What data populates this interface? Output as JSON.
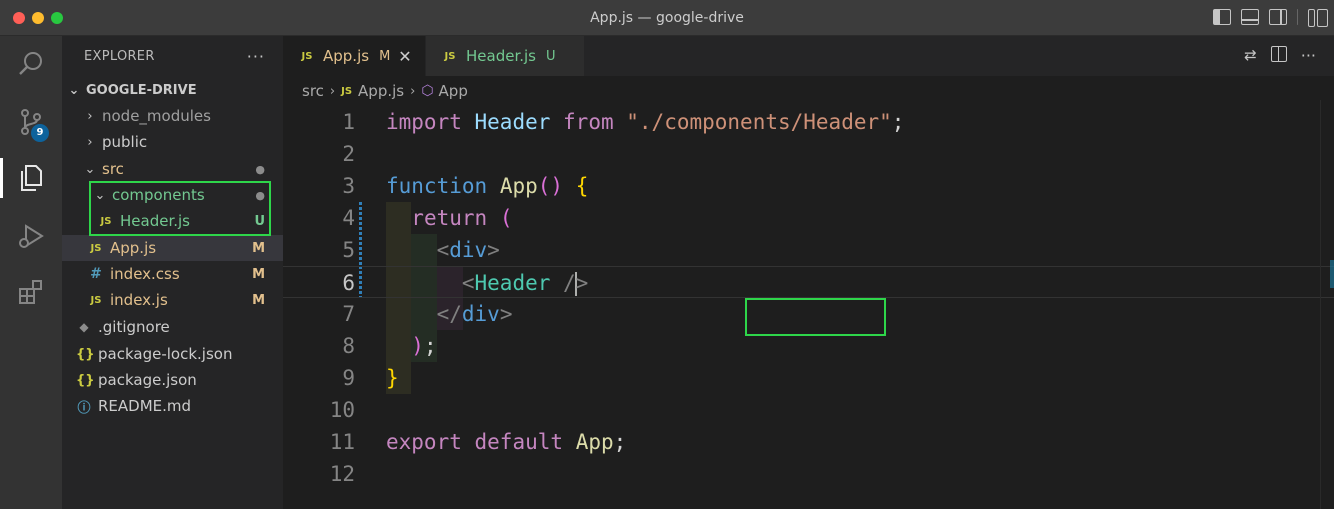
{
  "window": {
    "title": "App.js — google-drive"
  },
  "activity_bar": {
    "scm_badge": "9"
  },
  "sidebar": {
    "header_title": "EXPLORER",
    "more_actions": "···",
    "root": "GOOGLE-DRIVE",
    "items": [
      {
        "label": "node_modules",
        "twisty": "›",
        "status": ""
      },
      {
        "label": "public",
        "twisty": "›",
        "status": ""
      },
      {
        "label": "src",
        "twisty": "⌄",
        "status": "●"
      },
      {
        "label": "components",
        "twisty": "⌄",
        "status": "●"
      },
      {
        "label": "Header.js",
        "icon": "JS",
        "status": "U"
      },
      {
        "label": "App.js",
        "icon": "JS",
        "status": "M"
      },
      {
        "label": "index.css",
        "icon": "#",
        "status": "M"
      },
      {
        "label": "index.js",
        "icon": "JS",
        "status": "M"
      },
      {
        "label": ".gitignore",
        "icon": "◆",
        "status": ""
      },
      {
        "label": "package-lock.json",
        "icon": "{}",
        "status": ""
      },
      {
        "label": "package.json",
        "icon": "{}",
        "status": ""
      },
      {
        "label": "README.md",
        "icon": "ⓘ",
        "status": ""
      }
    ]
  },
  "tabs": [
    {
      "label": "App.js",
      "icon": "JS",
      "status": "M",
      "close": "✕"
    },
    {
      "label": "Header.js",
      "icon": "JS",
      "status": "U"
    }
  ],
  "breadcrumb": {
    "folder": "src",
    "file_icon": "JS",
    "file": "App.js",
    "symbol_icon": "⬡",
    "symbol": "App"
  },
  "code": {
    "line_numbers": [
      "1",
      "2",
      "3",
      "4",
      "5",
      "6",
      "7",
      "8",
      "9",
      "10",
      "11",
      "12"
    ],
    "l1": {
      "kw": "import",
      "ident": "Header",
      "from": "from",
      "str": "\"./components/Header\"",
      "semi": ";"
    },
    "l3": {
      "kw": "function",
      "name": "App",
      "parens": "()",
      "brace": "{"
    },
    "l4": {
      "kw": "return",
      "paren": "("
    },
    "l5": {
      "open": "<",
      "tag": "div",
      "close": ">"
    },
    "l6": {
      "open": "<",
      "comp": "Header",
      "slash": " /",
      "close": ">"
    },
    "l7": {
      "open": "</",
      "tag": "div",
      "close": ">"
    },
    "l8": {
      "paren": ")",
      "semi": ";"
    },
    "l9": {
      "brace": "}"
    },
    "l11": {
      "kw1": "export",
      "kw2": "default",
      "name": "App",
      "semi": ";"
    }
  },
  "colors": {
    "accent_highlight": "#2ed64a",
    "modified": "#e2c08d",
    "untracked": "#73c991",
    "js_icon": "#cbcb41"
  }
}
